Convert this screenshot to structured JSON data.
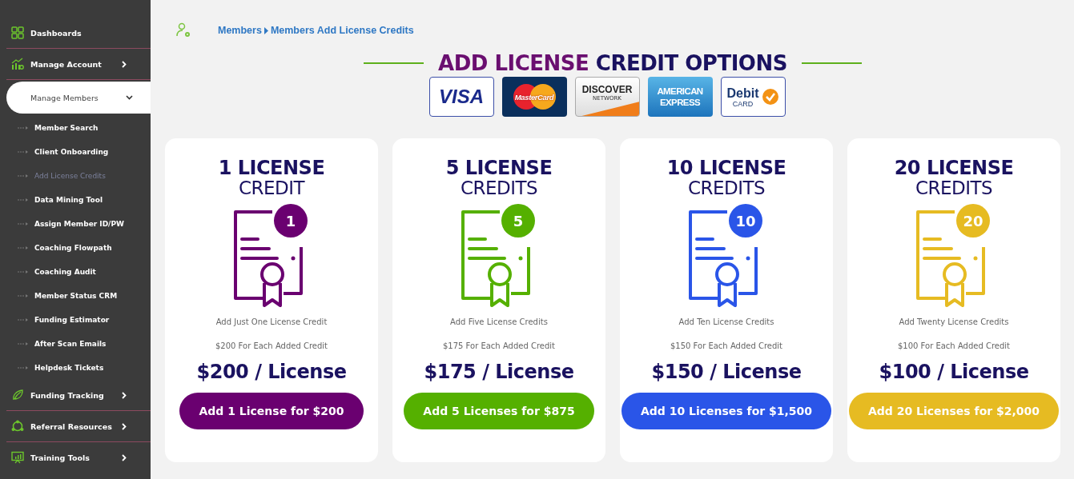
{
  "sidebar": {
    "items": [
      {
        "label": "Dashboards",
        "selected": false
      },
      {
        "label": "Manage Account",
        "selected": false,
        "expanded": false
      },
      {
        "label": "Manage Members",
        "selected": true,
        "expanded": true,
        "children": [
          {
            "label": "Member Search",
            "selected": false
          },
          {
            "label": "Client Onboarding",
            "selected": false
          },
          {
            "label": "Add License Credits",
            "selected": true
          },
          {
            "label": "Data Mining Tool",
            "selected": false
          },
          {
            "label": "Assign Member ID/PW",
            "selected": false
          },
          {
            "label": "Coaching Flowpath",
            "selected": false
          },
          {
            "label": "Coaching Audit",
            "selected": false
          },
          {
            "label": "Member Status CRM",
            "selected": false
          },
          {
            "label": "Funding Estimator",
            "selected": false
          },
          {
            "label": "After Scan Emails",
            "selected": false
          },
          {
            "label": "Helpdesk Tickets",
            "selected": false
          }
        ]
      },
      {
        "label": "Funding Tracking",
        "selected": false,
        "expanded": false
      },
      {
        "label": "Referral Resources",
        "selected": false,
        "expanded": false
      },
      {
        "label": "Training Tools",
        "selected": false,
        "expanded": false
      }
    ]
  },
  "breadcrumb": [
    "Members",
    "Members Add License Credits"
  ],
  "title_parts": [
    {
      "text": "ADD LICENSE",
      "color": "#6a0f70"
    },
    {
      "text": "CREDIT OPTIONS",
      "color": "#1a1260"
    }
  ],
  "payment_logos": [
    {
      "kind": "visa",
      "text": "VISA"
    },
    {
      "kind": "mastercard",
      "text": "MasterCard"
    },
    {
      "kind": "discover",
      "text": "DISCOVER",
      "subtext": "NETWORK"
    },
    {
      "kind": "amex",
      "text": "AMERICAN",
      "subtext": "EXPRESS"
    },
    {
      "kind": "debit",
      "text": "Debit",
      "subtext": "CARD"
    }
  ],
  "cards": [
    {
      "heading": "1 LICENSE",
      "subheading": "CREDIT",
      "badge": "1",
      "color": "#6a0070",
      "description": "Add Just One License Credit",
      "per_credit": "$200 For Each Added Credit",
      "price": "$200 / License",
      "button": "Add 1 License for $200"
    },
    {
      "heading": "5 LICENSE",
      "subheading": "CREDITS",
      "badge": "5",
      "color": "#55b000",
      "description": "Add Five License Credits",
      "per_credit": "$175 For Each Added Credit",
      "price": "$175 / License",
      "button": "Add 5 Licenses for $875"
    },
    {
      "heading": "10 LICENSE",
      "subheading": "CREDITS",
      "badge": "10",
      "color": "#2a55e8",
      "description": "Add Ten License Credits",
      "per_credit": "$150 For Each Added Credit",
      "price": "$150 / License",
      "button": "Add 10 Licenses for $1,500"
    },
    {
      "heading": "20 LICENSE",
      "subheading": "CREDITS",
      "badge": "20",
      "color": "#e6bb22",
      "description": "Add Twenty License Credits",
      "per_credit": "$100 For Each Added Credit",
      "price": "$100 / License",
      "button": "Add 20 Licenses for $2,000"
    }
  ]
}
